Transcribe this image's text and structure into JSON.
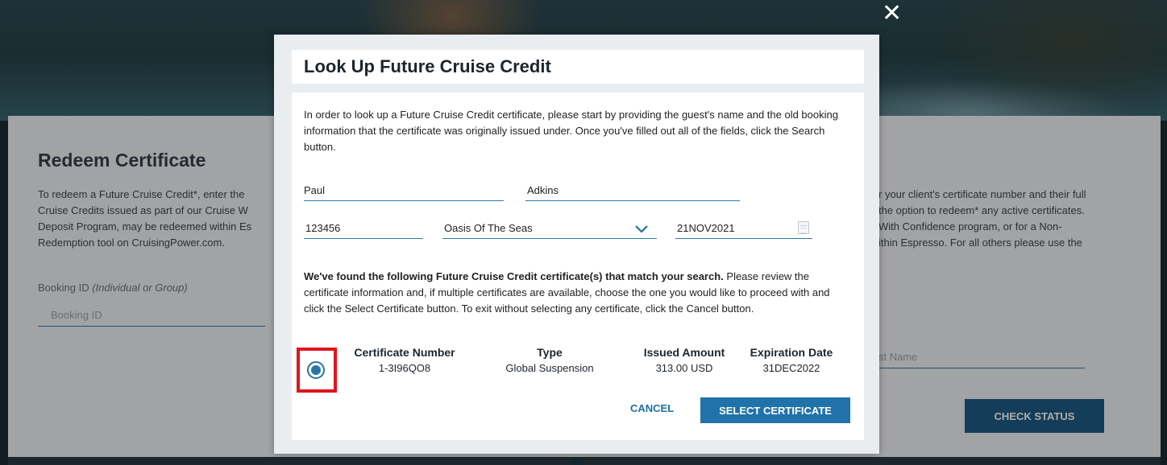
{
  "background": {
    "redeem_title": "Redeem Certificate",
    "redeem_desc": "To redeem a Future Cruise Credit*, enter the\nCruise Credits issued as part of our Cruise W\nDeposit Program, may be redeemed within Es\nRedemption tool on CruisingPower.com.",
    "right_desc": "r your client's certificate number and their full\n the option to redeem* any active certificates.\n With Confidence program, or for a Non-\nithin Espresso. For all others please use the",
    "booking_label": "Booking ID",
    "booking_label_italic": "(Individual or Group)",
    "booking_placeholder": "Booking ID",
    "lastname_placeholder": "st Name",
    "check_status_label": "CHECK STATUS"
  },
  "modal": {
    "title": "Look Up Future Cruise Credit",
    "intro": "In order to look up a Future Cruise Credit certificate, please start by providing the guest's name and the old booking information that the certificate was originally issued under. Once you've filled out all of the fields, click the Search button.",
    "form": {
      "first_name": "Paul",
      "last_name": "Adkins",
      "booking_number": "123456",
      "ship": "Oasis Of The Seas",
      "sail_date": "21NOV2021"
    },
    "found_bold": "We've found the following Future Cruise Credit certificate(s) that match your search.",
    "found_rest": " Please review the certificate information and, if multiple certificates are available, choose the one you would like to proceed with and click the Select Certificate button. To exit without selecting any certificate, click the Cancel button.",
    "columns": {
      "certificate_number": "Certificate Number",
      "type": "Type",
      "issued_amount": "Issued Amount",
      "expiration_date": "Expiration Date"
    },
    "certificate": {
      "number": "1-3I96QO8",
      "type": "Global Suspension",
      "amount": "313.00 USD",
      "expiration": "31DEC2022",
      "selected": true
    },
    "cancel_label": "CANCEL",
    "select_label": "SELECT CERTIFICATE",
    "close_glyph": "✕"
  },
  "colors": {
    "accent": "#1f72aa",
    "highlight": "#e0141c"
  }
}
